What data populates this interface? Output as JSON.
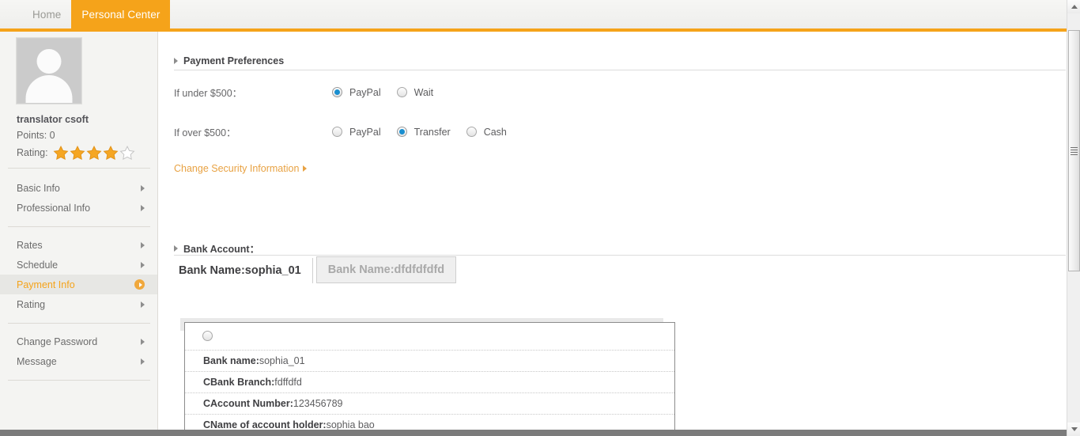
{
  "header": {
    "tabs": [
      {
        "label": "Home",
        "active": false
      },
      {
        "label": "Personal Center",
        "active": true
      }
    ]
  },
  "sidebar": {
    "profile": {
      "name": "translator csoft",
      "points_label": "Points: 0",
      "rating_label": "Rating:",
      "rating_filled": 4,
      "rating_total": 5
    },
    "groups": [
      {
        "items": [
          {
            "label": "Basic Info",
            "active": false
          },
          {
            "label": "Professional Info",
            "active": false
          }
        ]
      },
      {
        "items": [
          {
            "label": "Rates",
            "active": false
          },
          {
            "label": "Schedule",
            "active": false
          },
          {
            "label": "Payment Info",
            "active": true
          },
          {
            "label": "Rating",
            "active": false
          }
        ]
      },
      {
        "items": [
          {
            "label": "Change Password",
            "active": false
          },
          {
            "label": "Message",
            "active": false
          }
        ]
      }
    ]
  },
  "main": {
    "payment_preferences": {
      "heading": "Payment Preferences",
      "rows": [
        {
          "label": "If under $500：",
          "options": [
            {
              "label": "PayPal",
              "checked": true
            },
            {
              "label": "Wait",
              "checked": false
            }
          ]
        },
        {
          "label": "If over $500：",
          "options": [
            {
              "label": "PayPal",
              "checked": false
            },
            {
              "label": "Transfer",
              "checked": true
            },
            {
              "label": "Cash",
              "checked": false
            }
          ]
        }
      ],
      "security_link": "Change Security Information"
    },
    "bank_account": {
      "heading": "Bank Account：",
      "tabs": [
        {
          "label": "Bank Name:sophia_01",
          "active": true
        },
        {
          "label": "Bank Name:dfdfdfdfd",
          "active": false
        }
      ],
      "details": {
        "selected": false,
        "rows": [
          {
            "label": "Bank name:",
            "value": "sophia_01"
          },
          {
            "label": "CBank Branch:",
            "value": "fdffdfd"
          },
          {
            "label": "CAccount Number:",
            "value": "123456789"
          },
          {
            "label": "CName of account holder:",
            "value": "sophia bao"
          }
        ]
      }
    }
  },
  "colors": {
    "accent": "#f5a31a",
    "link": "#e8a243",
    "radio_checked": "#1a8fd0"
  }
}
